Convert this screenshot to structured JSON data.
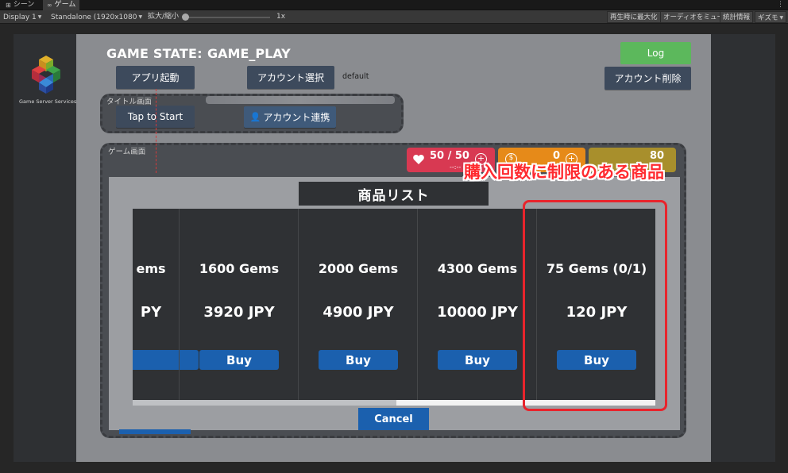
{
  "editor": {
    "tabs": [
      {
        "label": "シーン",
        "icon": "grid-icon"
      },
      {
        "label": "ゲーム",
        "icon": "gamepad-icon"
      }
    ],
    "toolbar": {
      "display": "Display 1",
      "resolution": "Standalone (1920x1080",
      "scale_label": "拡大/縮小",
      "scale_value": "1x",
      "buttons": [
        "再生時に最大化",
        "オーディオをミュート",
        "統計情報",
        "ギズモ"
      ]
    }
  },
  "logo": {
    "caption": "Game Server Services"
  },
  "game": {
    "state_label": "GAME STATE:",
    "state_value": "GAME_PLAY",
    "log_button": "Log",
    "app_start_button": "アプリ起動",
    "account_select_button": "アカウント選択",
    "account_select_value": "default",
    "account_delete_button": "アカウント削除",
    "title_section": {
      "label": "タイトル画面",
      "tap_to_start": "Tap to Start",
      "account_link": "アカウント連携"
    },
    "game_section": {
      "label": "ゲーム画面"
    },
    "hud": {
      "life": "50 / 50",
      "coins": "0",
      "gems": "80",
      "subtext": "--:--"
    }
  },
  "shop": {
    "title": "商品リスト",
    "products": [
      {
        "name": "ems",
        "price": "PY",
        "buy": ""
      },
      {
        "name": "1600 Gems",
        "price": "3920 JPY",
        "buy": "Buy"
      },
      {
        "name": "2000 Gems",
        "price": "4900 JPY",
        "buy": "Buy"
      },
      {
        "name": "4300 Gems",
        "price": "10000 JPY",
        "buy": "Buy"
      },
      {
        "name": "75 Gems (0/1)",
        "price": "120 JPY",
        "buy": "Buy"
      }
    ],
    "cancel": "Cancel",
    "scroll_position": 0.5
  },
  "annotation": {
    "callout": "購入回数に制限のある商品",
    "color": "#e8242c"
  }
}
